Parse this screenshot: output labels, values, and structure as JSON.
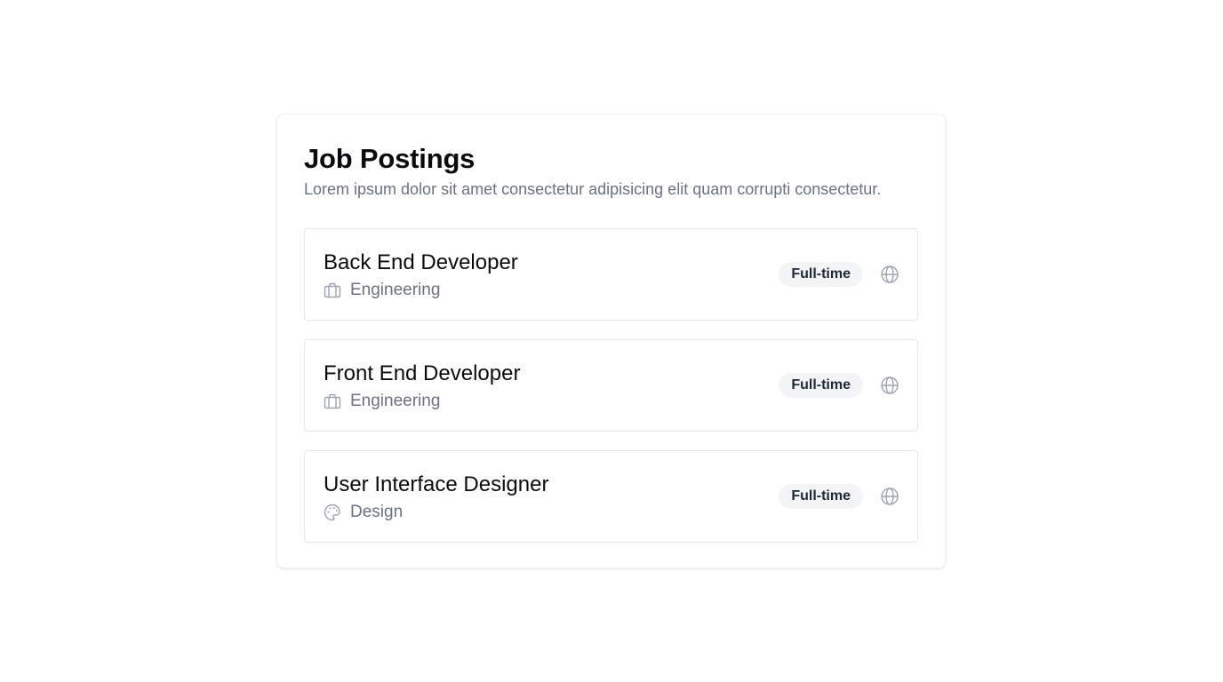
{
  "header": {
    "title": "Job Postings",
    "subtitle": "Lorem ipsum dolor sit amet consectetur adipisicing elit quam corrupti consectetur."
  },
  "jobs": [
    {
      "title": "Back End Developer",
      "department": "Engineering",
      "department_icon": "briefcase-icon",
      "type": "Full-time",
      "location_icon": "globe-icon"
    },
    {
      "title": "Front End Developer",
      "department": "Engineering",
      "department_icon": "briefcase-icon",
      "type": "Full-time",
      "location_icon": "globe-icon"
    },
    {
      "title": "User Interface Designer",
      "department": "Design",
      "department_icon": "palette-icon",
      "type": "Full-time",
      "location_icon": "globe-icon"
    }
  ],
  "colors": {
    "text_primary": "#0b0b0f",
    "text_muted": "#6b7280",
    "badge_bg": "#f3f4f6",
    "border": "#e5e7eb",
    "icon": "#9ca3af"
  }
}
